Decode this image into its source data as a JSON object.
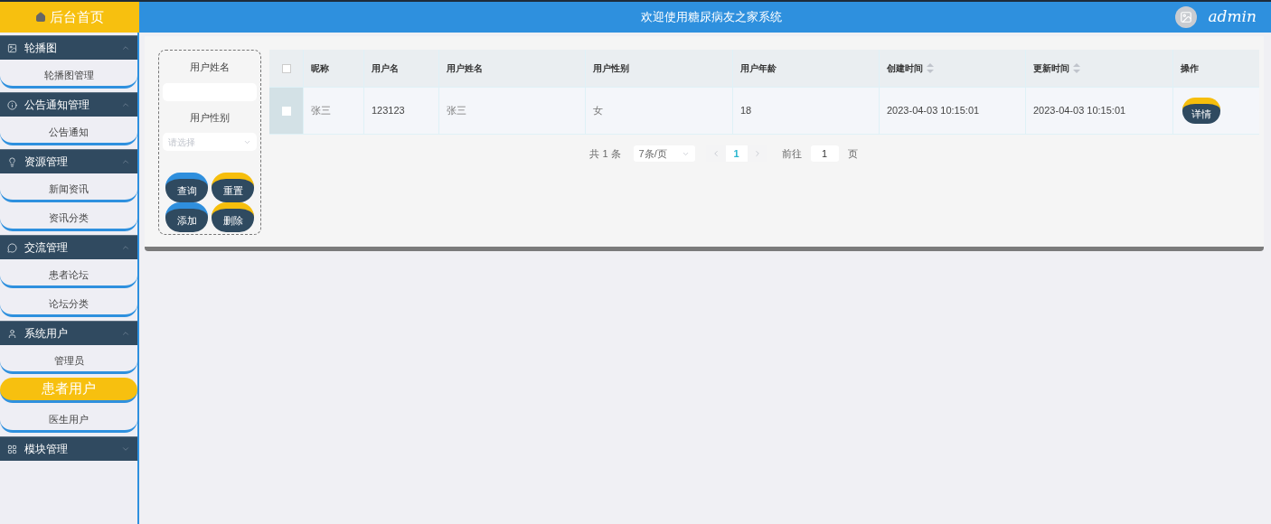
{
  "header": {
    "home": "后台首页",
    "title": "欢迎使用糖尿病友之家系统",
    "user": "admin"
  },
  "sidebar": {
    "groups": [
      {
        "title": "轮播图",
        "expanded": true,
        "items": [
          {
            "label": "轮播图管理",
            "selected": false
          }
        ]
      },
      {
        "title": "公告通知管理",
        "expanded": true,
        "items": [
          {
            "label": "公告通知",
            "selected": false
          }
        ]
      },
      {
        "title": "资源管理",
        "expanded": true,
        "items": [
          {
            "label": "新闻资讯",
            "selected": false
          },
          {
            "label": "资讯分类",
            "selected": false
          }
        ]
      },
      {
        "title": "交流管理",
        "expanded": true,
        "items": [
          {
            "label": "患者论坛",
            "selected": false
          },
          {
            "label": "论坛分类",
            "selected": false
          }
        ]
      },
      {
        "title": "系统用户",
        "expanded": true,
        "items": [
          {
            "label": "管理员",
            "selected": false
          },
          {
            "label": "患者用户",
            "selected": true
          },
          {
            "label": "医生用户",
            "selected": false
          }
        ]
      },
      {
        "title": "模块管理",
        "expanded": false
      }
    ]
  },
  "search": {
    "fields": [
      {
        "label": "用户姓名",
        "kind": "input"
      },
      {
        "label": "用户性别",
        "kind": "select",
        "placeholder": "请选择"
      }
    ],
    "buttons": [
      {
        "label": "查询",
        "color": "#2f8fdd"
      },
      {
        "label": "重置",
        "color": "#f6be0c"
      },
      {
        "label": "添加",
        "color": "#2f8fdd"
      },
      {
        "label": "删除",
        "color": "#f6be0c"
      }
    ]
  },
  "table": {
    "columns": [
      {
        "label": "昵称",
        "sortable": false
      },
      {
        "label": "用户名",
        "sortable": false
      },
      {
        "label": "用户姓名",
        "sortable": false
      },
      {
        "label": "用户性别",
        "sortable": false
      },
      {
        "label": "用户年龄",
        "sortable": false
      },
      {
        "label": "创建时间",
        "sortable": true
      },
      {
        "label": "更新时间",
        "sortable": true
      },
      {
        "label": "操作",
        "sortable": false
      }
    ],
    "all_checked": false,
    "rows": [
      {
        "checked": false,
        "cells": [
          "张三",
          "123123",
          "张三",
          "女",
          "18",
          "2023-04-03 10:15:01",
          "2023-04-03 10:15:01"
        ],
        "action": "详情"
      }
    ]
  },
  "pagination": {
    "total": "共 1 条",
    "page_size": "7条/页",
    "pages": [
      {
        "label": "1",
        "selected": true
      }
    ],
    "goto_label": "前往",
    "goto_value": "1",
    "goto_suffix": "页"
  }
}
